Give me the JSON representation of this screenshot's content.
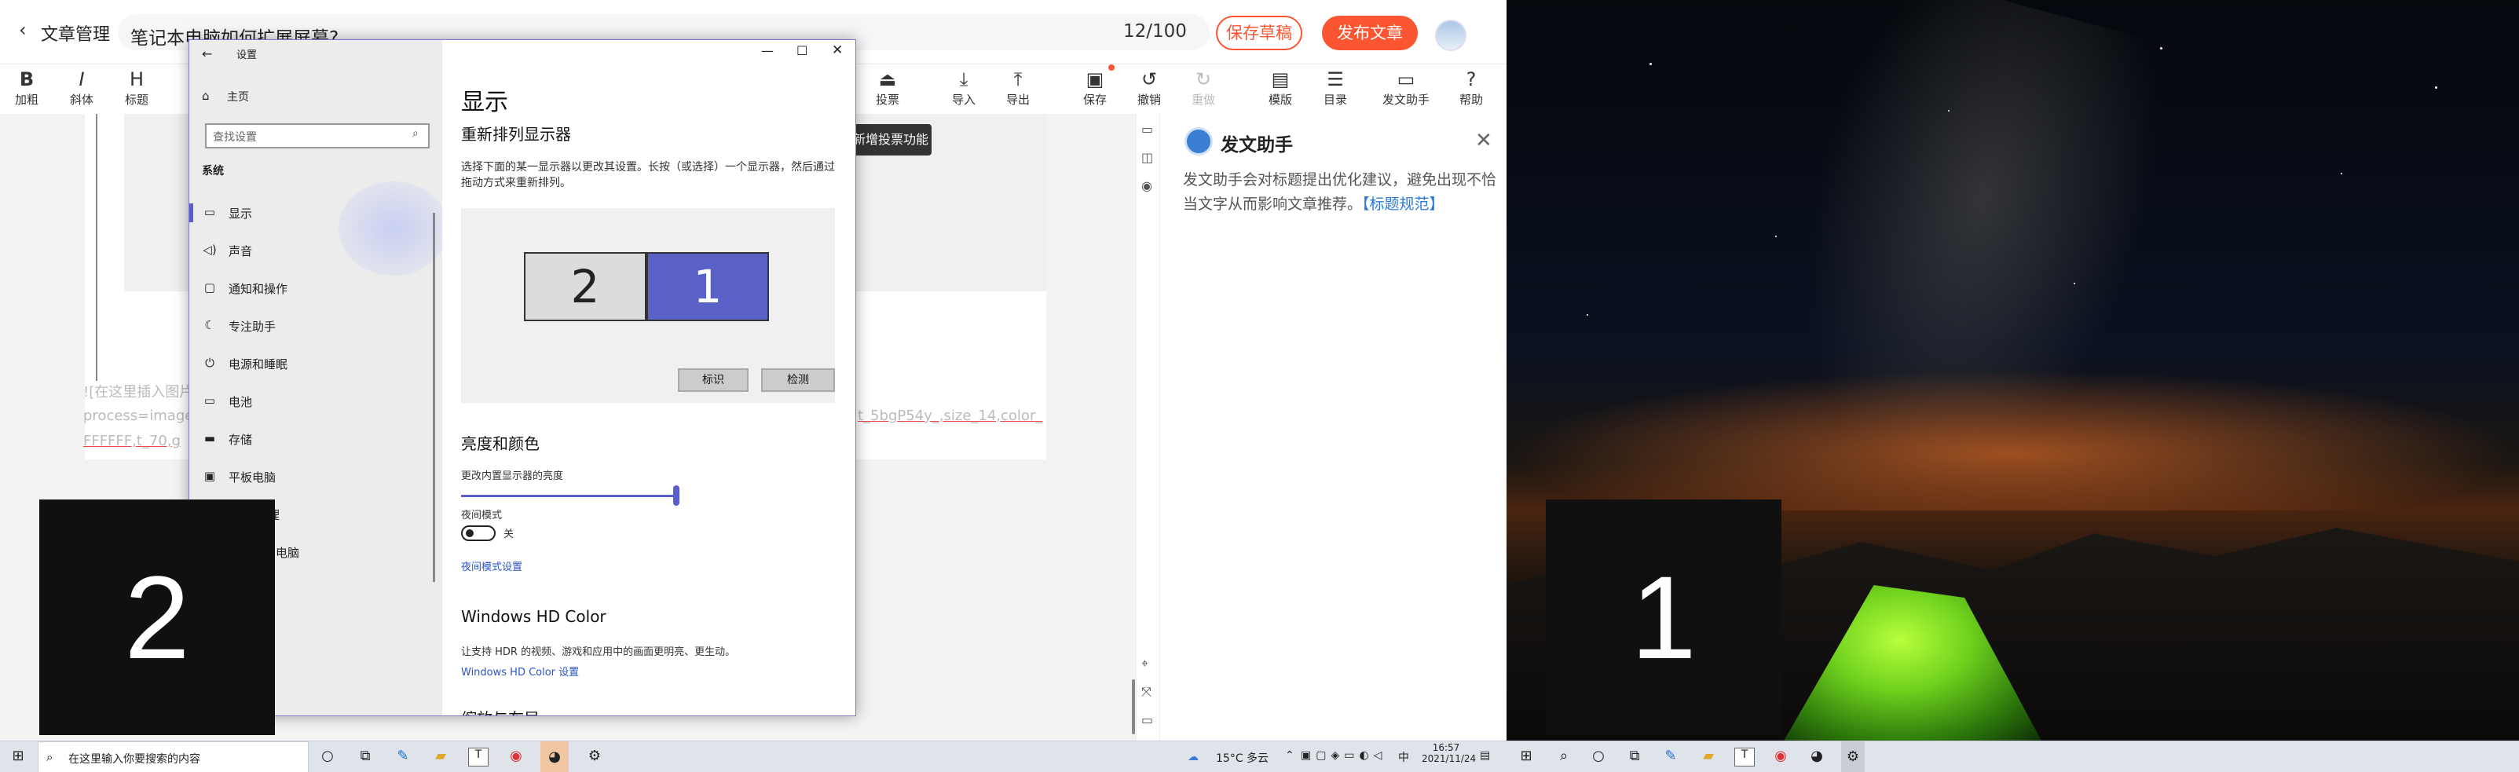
{
  "editor": {
    "back_label": "文章管理",
    "title": "笔记本电脑如何扩展屏幕?",
    "counter": "12/100",
    "save_draft": "保存草稿",
    "publish": "发布文章",
    "toolbar": [
      "加粗",
      "斜体",
      "标题",
      "投票",
      "导入",
      "导出",
      "保存",
      "撤销",
      "重做",
      "模版",
      "目录",
      "发文助手",
      "帮助"
    ],
    "toolbar_icons": [
      "B",
      "I",
      "H",
      "vote-icon",
      "import-icon",
      "export-icon",
      "save-icon",
      "undo-icon",
      "redo-icon",
      "template-icon",
      "toc-icon",
      "assistant-icon",
      "help-icon"
    ],
    "tooltip": "新增投票功能",
    "body_line1": "![在这里插入图片",
    "body_line2": "process=image",
    "body_line3": "FFFFFF,t_70,g",
    "body_line_right": "t_5bgP54y_,size_14,color_"
  },
  "assistant": {
    "title": "发文助手",
    "desc": "发文助手会对标题提出优化建议，避免出现不恰当文字从而影响文章推荐。",
    "link": "【标题规范】"
  },
  "settings": {
    "window_title": "设置",
    "home": "主页",
    "search_placeholder": "查找设置",
    "section": "系统",
    "nav": [
      {
        "icon": "monitor-icon",
        "label": "显示"
      },
      {
        "icon": "sound-icon",
        "label": "声音"
      },
      {
        "icon": "notification-icon",
        "label": "通知和操作"
      },
      {
        "icon": "focus-icon",
        "label": "专注助手"
      },
      {
        "icon": "power-icon",
        "label": "电源和睡眠"
      },
      {
        "icon": "battery-icon",
        "label": "电池"
      },
      {
        "icon": "storage-icon",
        "label": "存储"
      },
      {
        "icon": "tablet-icon",
        "label": "平板电脑"
      },
      {
        "icon": "multitask-icon",
        "label": "理"
      },
      {
        "icon": "project-icon",
        "label": "电脑"
      }
    ],
    "page_title": "显示",
    "rearrange_title": "重新排列显示器",
    "rearrange_desc": "选择下面的某一显示器以更改其设置。长按（或选择）一个显示器，然后通过拖动方式来重新排列。",
    "monitor_left": "2",
    "monitor_right": "1",
    "identify": "标识",
    "detect": "检测",
    "brightness_title": "亮度和颜色",
    "brightness_label": "更改内置显示器的亮度",
    "brightness_value": 1.0,
    "night_mode": "夜间模式",
    "night_state": "关",
    "night_settings": "夜间模式设置",
    "hdr_title": "Windows HD Color",
    "hdr_desc": "让支持 HDR 的视频、游戏和应用中的画面更明亮、更生动。",
    "hdr_link": "Windows HD Color 设置",
    "next_title": "缩放与布局"
  },
  "identify_tiles": {
    "screen_left": "2",
    "screen_right": "1"
  },
  "taskbar": {
    "search_placeholder": "在这里输入你要搜索的内容",
    "weather": "15°C 多云",
    "ime": "中",
    "time": "16:57",
    "date": "2021/11/24"
  },
  "colors": {
    "accent": "#fc5531",
    "windows_accent": "#5a5ed0",
    "monitor_selected": "#5a61c7"
  }
}
